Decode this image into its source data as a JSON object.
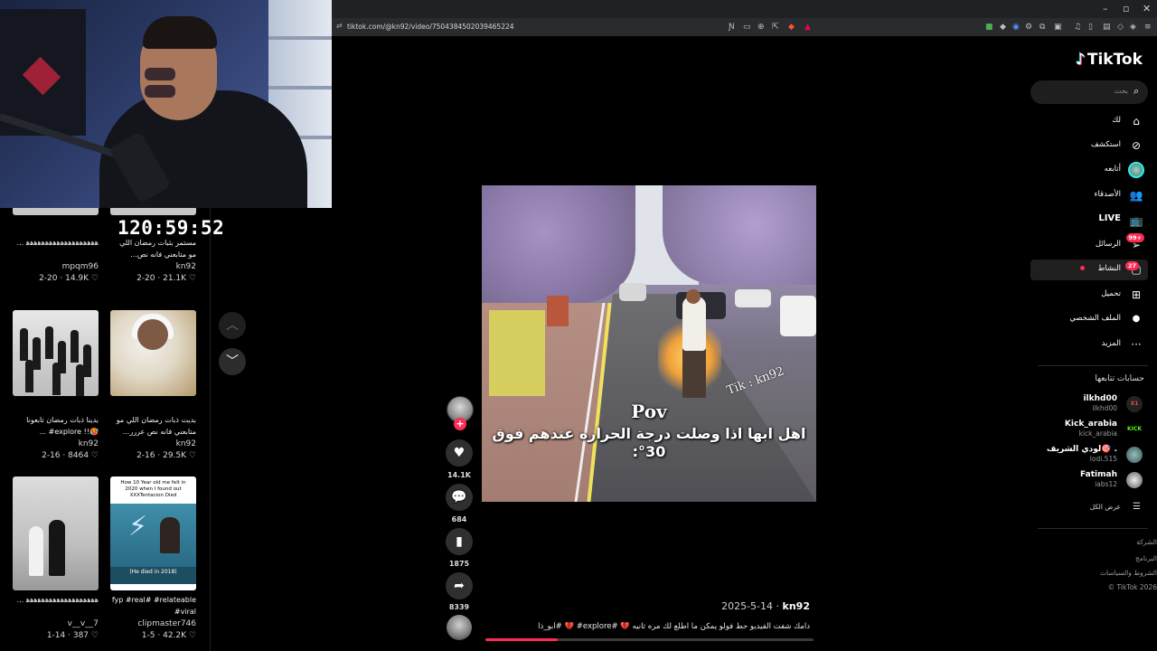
{
  "browser": {
    "url": "tiktok.com/@kn92/video/7504384502039465224"
  },
  "stream": {
    "timer": "120:59:52"
  },
  "feed": {
    "cards": [
      {
        "title": "ﻫﻫﻫﻫﻫﻫﻫﻫﻫﻫﻫﻫﻫﻫﻫﻫﻫﻫﻫ ...",
        "user": "mpqm96",
        "date": "2-20",
        "likes": "14.9K"
      },
      {
        "title": "مستمر بثبات رمضان اللي مو متابعني فانه نص...",
        "user": "kn92",
        "date": "2-20",
        "likes": "21.1K"
      },
      {
        "title": "بدينا ذبات رمضان تابعونا 🥵!! explore# ...",
        "user": "kn92",
        "date": "2-16",
        "likes": "8464"
      },
      {
        "title": "بديت ذبات رمضان اللي مو متابعني فانه نص عررر...",
        "user": "kn92",
        "date": "2-16",
        "likes": "29.5K"
      },
      {
        "title": "ﻫﻫﻫﻫﻫﻫﻫﻫﻫﻫﻫﻫﻫﻫﻫﻫﻫﻫﻫ ...",
        "user": "v__v__7",
        "date": "1-14",
        "likes": "387"
      },
      {
        "title": "fyp #real# #relateable #viral",
        "user": "clipmaster746",
        "date": "1-5",
        "likes": "42.2K"
      }
    ],
    "meme_caption": "How 10 Year old me felt in 2020 when I found out XXXTentacion Died",
    "meme_bottom": "(He died in 2018)"
  },
  "video": {
    "pov_text": "Pov",
    "overlay_text": "اهل ابها اذا وصلت درجة الحراره عندهم فوق 30°:",
    "watermark": "Tik : kn92",
    "likes": "14.1K",
    "comments": "684",
    "saves": "1875",
    "shares": "8339",
    "progress": 0.22
  },
  "post": {
    "date": "2025-5-14",
    "author": "kn92",
    "description": "دامك شفت الفيديو حط فولو يمكن ما اطلع لك مره ثانيه 💔 #explore# 💔 #أبو_ذا"
  },
  "sidebar": {
    "logo": "TikTok",
    "search_placeholder": "بحث",
    "menu": [
      {
        "label": "لك",
        "icon": "home-icon"
      },
      {
        "label": "استكشف",
        "icon": "compass-icon"
      },
      {
        "label": "أتابعه",
        "icon": "following-avatar-icon"
      },
      {
        "label": "الأصدقاء",
        "icon": "friends-icon"
      },
      {
        "label": "LIVE",
        "icon": "live-icon"
      },
      {
        "label": "الرسائل",
        "icon": "messages-icon",
        "badge": "99+"
      },
      {
        "label": "النشاط",
        "icon": "activity-icon",
        "badge": "27"
      },
      {
        "label": "تحميل",
        "icon": "upload-icon"
      },
      {
        "label": "الملف الشخصي",
        "icon": "profile-avatar-icon"
      },
      {
        "label": "المزيد",
        "icon": "more-icon"
      }
    ],
    "following_title": "حسابات تتابعها",
    "following": [
      {
        "name": "ilkhd00",
        "handle": "ilkhd00"
      },
      {
        "name": "Kick_arabia",
        "handle": "kick_arabia"
      },
      {
        "name": "لودي الشريف🎯 .",
        "handle": "lodi.515"
      },
      {
        "name": "Fatimah",
        "handle": "iabs12"
      }
    ],
    "see_all": "عرض الكل",
    "footer": [
      "الشركة",
      "البرنامج",
      "الشروط والسياسات",
      "© TikTok 2026"
    ]
  },
  "colors": {
    "accent": "#fe2c55",
    "cyan": "#25f4ee",
    "background": "#000000"
  }
}
